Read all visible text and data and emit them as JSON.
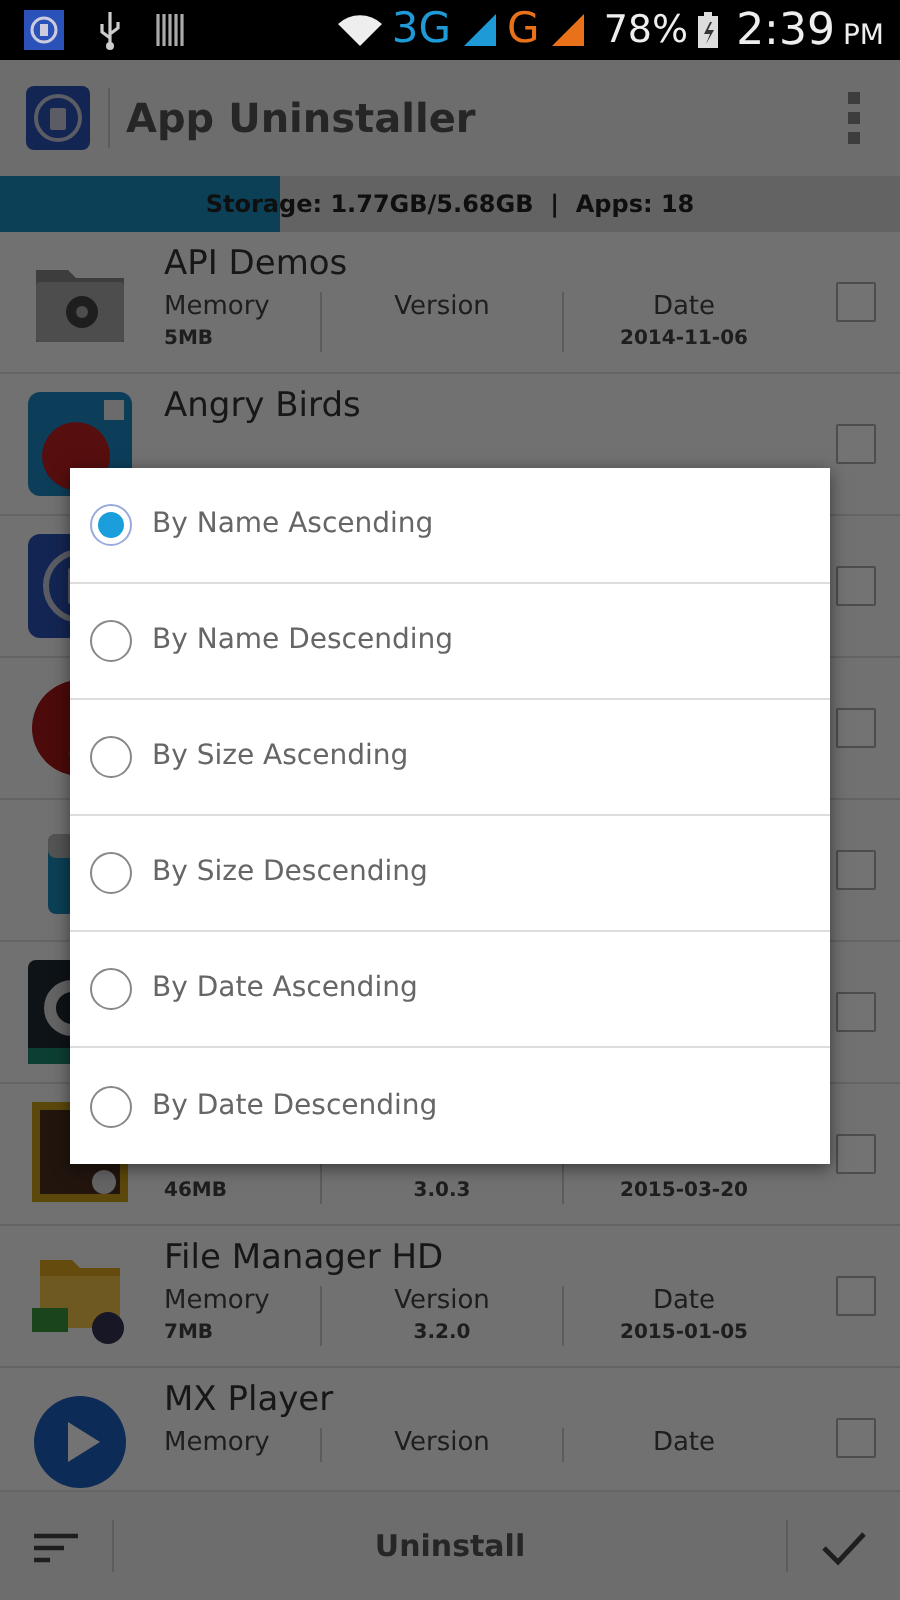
{
  "status_bar": {
    "time": "2:39",
    "ampm": "PM",
    "battery": "78%",
    "networks": [
      {
        "label": "3G",
        "color": "#1e9bd7"
      },
      {
        "label": "G",
        "color": "#e8711a"
      }
    ]
  },
  "app_bar": {
    "title": "App Uninstaller"
  },
  "storage": {
    "text": "Storage: 1.77GB/5.68GB  |  Apps: 18",
    "level": 0.31
  },
  "apps": [
    {
      "name": "API Demos",
      "checked": false,
      "columns": [
        {
          "label": "Memory",
          "value": "5MB"
        },
        {
          "label": "Version"
        },
        {
          "label": "Date",
          "value": "2014-11-06"
        }
      ]
    },
    {
      "name": "Angry Birds",
      "checked": false
    },
    {
      "checked": false
    },
    {
      "checked": false
    },
    {
      "checked": false
    },
    {
      "checked": false
    },
    {
      "checked": false,
      "columns": [
        {
          "value": "46MB"
        },
        {
          "value": "3.0.3"
        },
        {
          "value": "2015-03-20"
        }
      ]
    },
    {
      "name": "File Manager HD",
      "checked": false,
      "columns": [
        {
          "label": "Memory",
          "value": "7MB"
        },
        {
          "label": "Version",
          "value": "3.2.0"
        },
        {
          "label": "Date",
          "value": "2015-01-05"
        }
      ]
    },
    {
      "name": "MX Player",
      "checked": false,
      "columns": [
        {
          "label": "Memory"
        },
        {
          "label": "Version"
        },
        {
          "label": "Date"
        }
      ]
    }
  ],
  "bottom_bar": {
    "action": "Uninstall"
  },
  "sort_dialog": {
    "options": [
      {
        "label": "By Name Ascending",
        "selected": true
      },
      {
        "label": "By Name Descending",
        "selected": false
      },
      {
        "label": "By Size Ascending",
        "selected": false
      },
      {
        "label": "By Size Descending",
        "selected": false
      },
      {
        "label": "By Date Ascending",
        "selected": false
      },
      {
        "label": "By Date Descending",
        "selected": false
      }
    ]
  }
}
